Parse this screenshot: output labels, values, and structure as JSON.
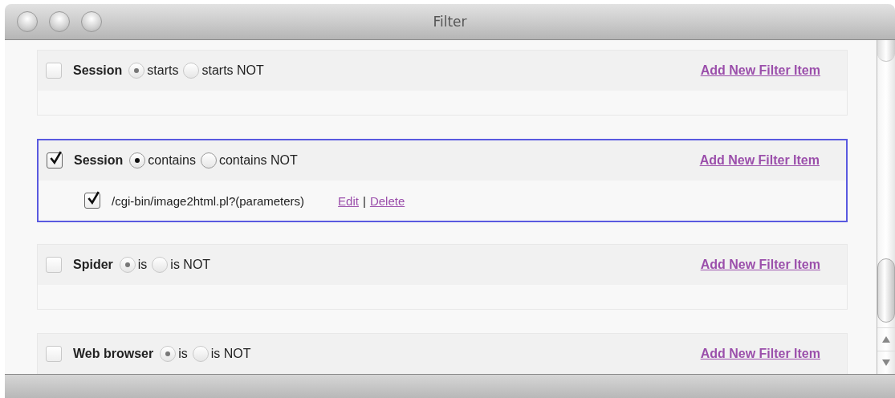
{
  "window": {
    "title": "Filter"
  },
  "filters": [
    {
      "label": "Session",
      "checked": false,
      "focused": false,
      "options": [
        {
          "label": "starts",
          "selected": true
        },
        {
          "label": "starts NOT",
          "selected": false
        }
      ],
      "add_link": "Add New Filter Item"
    },
    {
      "label": "Session",
      "checked": true,
      "focused": true,
      "options": [
        {
          "label": "contains",
          "selected": true
        },
        {
          "label": "contains NOT",
          "selected": false
        }
      ],
      "add_link": "Add New Filter Item",
      "items": [
        {
          "path": "/cgi-bin/image2html.pl?(parameters)",
          "checked": true,
          "edit": "Edit",
          "separator": "|",
          "delete": "Delete"
        }
      ]
    },
    {
      "label": "Spider",
      "checked": false,
      "focused": false,
      "options": [
        {
          "label": "is",
          "selected": true
        },
        {
          "label": "is NOT",
          "selected": false
        }
      ],
      "add_link": "Add New Filter Item"
    },
    {
      "label": "Web browser",
      "checked": false,
      "focused": false,
      "options": [
        {
          "label": "is",
          "selected": true
        },
        {
          "label": "is NOT",
          "selected": false
        }
      ],
      "add_link": "Add New Filter Item"
    }
  ]
}
